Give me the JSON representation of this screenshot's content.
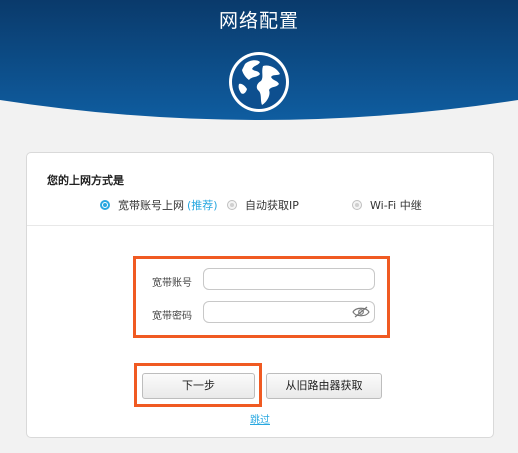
{
  "header": {
    "title": "网络配置"
  },
  "form": {
    "question": "您的上网方式是",
    "options": [
      {
        "label": "宽带账号上网",
        "note": "(推荐)",
        "selected": true
      },
      {
        "label": "自动获取IP",
        "selected": false
      },
      {
        "label": "Wi-Fi 中继",
        "selected": false
      }
    ],
    "account_label": "宽带账号",
    "account_value": "",
    "password_label": "宽带密码",
    "password_value": ""
  },
  "actions": {
    "next_label": "下一步",
    "fetch_label": "从旧路由器获取",
    "skip_label": "跳过"
  },
  "colors": {
    "accent": "#29a8e0",
    "highlight": "#f05a22",
    "header_top": "#0b3f73",
    "header_bottom": "#0d5a9c"
  },
  "icons": {
    "globe": "globe-icon",
    "show_password": "eye-icon"
  }
}
